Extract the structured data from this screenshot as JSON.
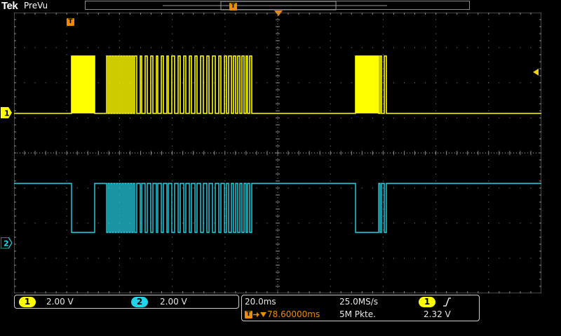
{
  "header": {
    "brand": "Tek",
    "mode": "PreVu"
  },
  "trigger": {
    "marker_label": "T"
  },
  "channels": [
    {
      "id": "1",
      "color": "#ffff00",
      "scale": "2.00 V"
    },
    {
      "id": "2",
      "color": "#22d4e8",
      "scale": "2.00 V"
    }
  ],
  "timebase": {
    "time_per_div": "20.0ms",
    "sample_rate": "25.0MS/s",
    "trigger_position": "78.60000ms",
    "record_length": "5M Pkte.",
    "trigger_source": "1",
    "trigger_slope_icon": "rising-edge-icon",
    "trigger_level": "2.32 V"
  },
  "colors": {
    "grid": "#8a8a8a",
    "trigger": "#f08a00",
    "background": "#000000"
  }
}
